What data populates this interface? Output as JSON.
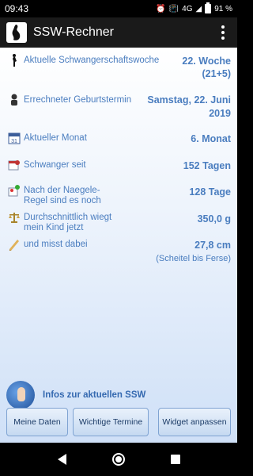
{
  "status_bar": {
    "time": "09:43",
    "network": "4G",
    "battery": "91 %"
  },
  "app_bar": {
    "title": "SSW-Rechner"
  },
  "rows": [
    {
      "label": "Aktuelle Schwangerschaftswoche",
      "value_line1": "22. Woche",
      "value_line2": "(21+5)",
      "icon": "pregnant-figure-icon"
    },
    {
      "label": "Errechneter Geburtstermin",
      "value_line1": "Samstag, 22. Juni",
      "value_line2": "2019",
      "icon": "baby-icon"
    },
    {
      "label": "Aktueller Monat",
      "value": "6. Monat",
      "icon": "calendar-icon"
    },
    {
      "label": "Schwanger seit",
      "value": "152 Tagen",
      "icon": "calendar-stamp-icon"
    },
    {
      "label": "Nach der Naegele-Regel sind es noch",
      "value": "128 Tage",
      "icon": "pin-calendar-icon"
    },
    {
      "label": "Durchschnittlich wiegt mein Kind jetzt",
      "value": "350,0 g",
      "icon": "scale-icon"
    },
    {
      "label": "und misst dabei",
      "value": "27,8 cm",
      "sub": "(Scheitel bis Ferse)",
      "icon": "ruler-icon"
    }
  ],
  "info": {
    "label": "Infos zur aktuellen SSW"
  },
  "buttons": {
    "my_data": "Meine Daten",
    "important_dates": "Wichtige Termine",
    "widget": "Widget anpassen"
  },
  "colors": {
    "accent_text": "#4a7dbf",
    "app_bar": "#1a1a1a"
  }
}
